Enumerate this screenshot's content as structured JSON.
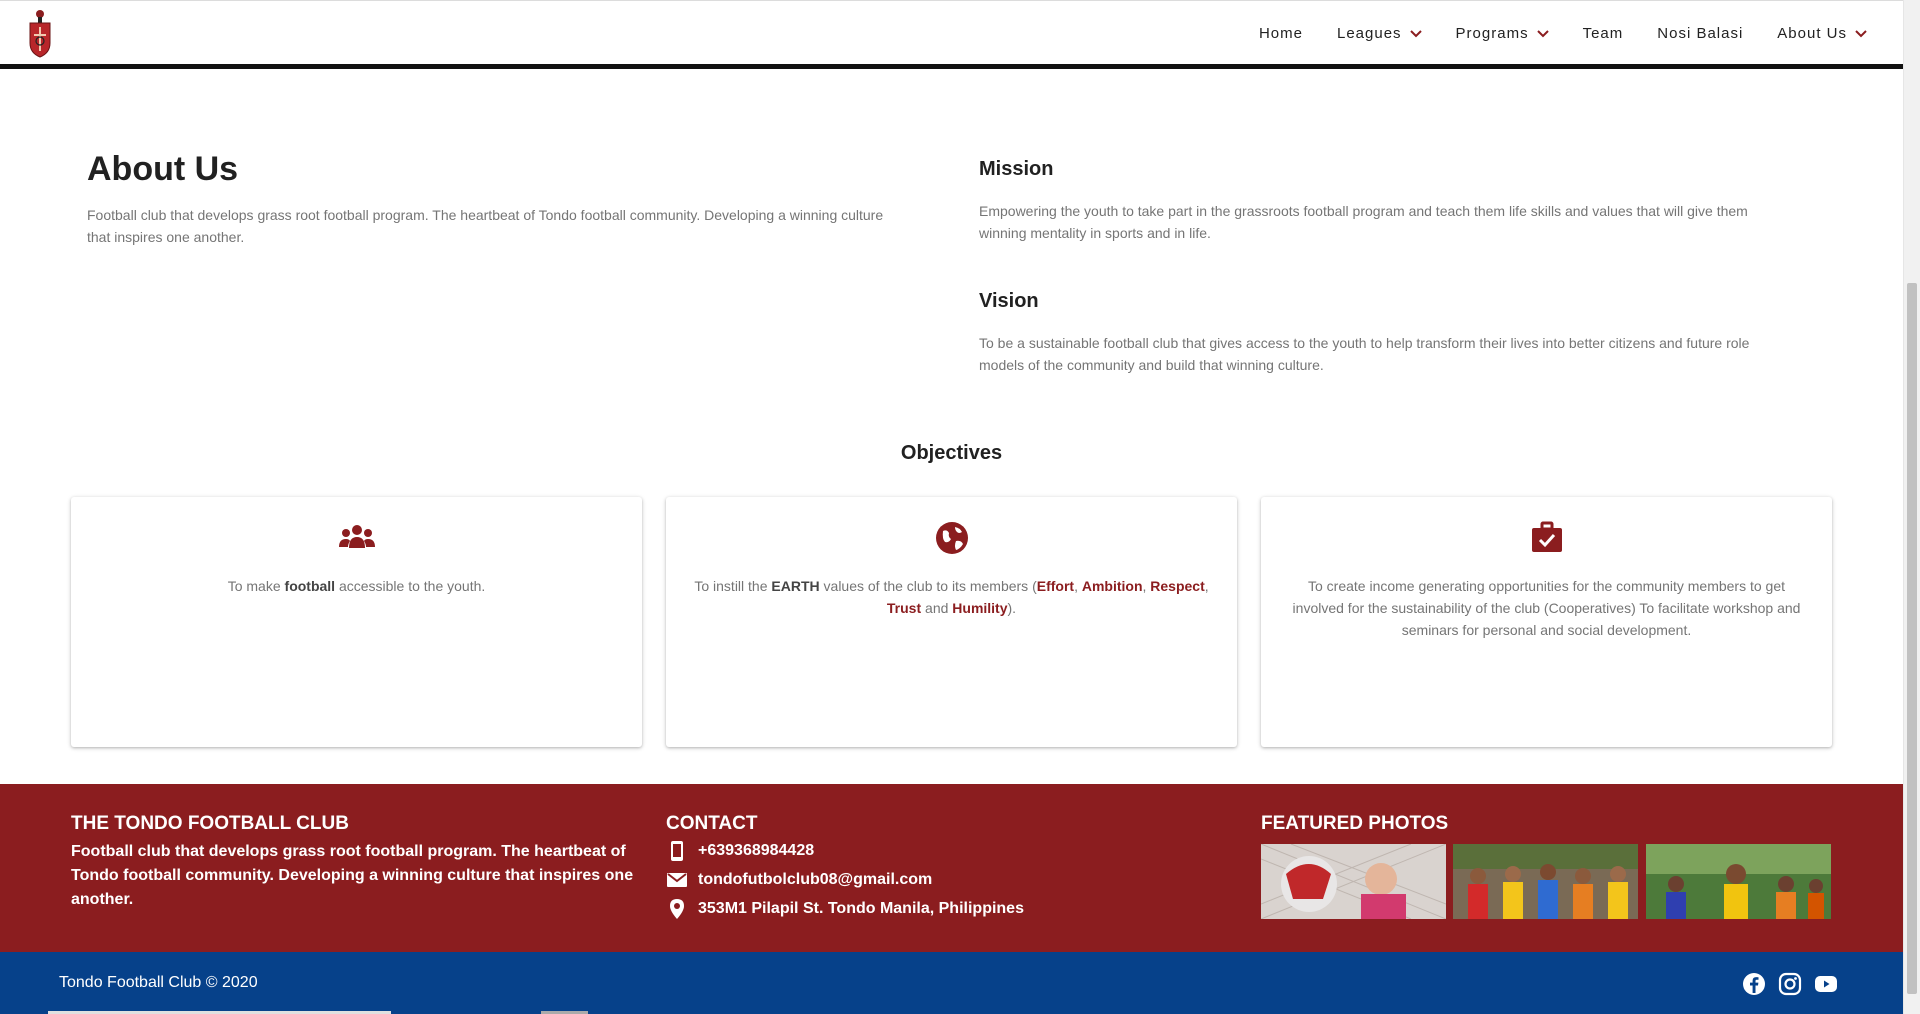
{
  "nav": {
    "logo_alt": "Tondo Football Club crest",
    "items": [
      {
        "label": "Home",
        "has_dropdown": false
      },
      {
        "label": "Leagues",
        "has_dropdown": true
      },
      {
        "label": "Programs",
        "has_dropdown": true
      },
      {
        "label": "Team",
        "has_dropdown": false
      },
      {
        "label": "Nosi Balasi",
        "has_dropdown": false
      },
      {
        "label": "About Us",
        "has_dropdown": true
      }
    ]
  },
  "about": {
    "title": "About Us",
    "text": "Football club that develops grass root football program. The heartbeat of Tondo football community. Developing a winning culture that inspires one another."
  },
  "mission": {
    "title": "Mission",
    "text": "Empowering the youth to take part in the grassroots football program and teach them life skills and values that will give them winning mentality in sports and in life."
  },
  "vision": {
    "title": "Vision",
    "text": "To be a sustainable football club that gives access to the youth to help transform their lives into better citizens and future role models of the community and build that winning culture."
  },
  "objectives": {
    "title": "Objectives",
    "cards": [
      {
        "icon": "group-icon",
        "pre": "To make ",
        "bold": "football",
        "post": " accessible to the youth."
      },
      {
        "icon": "globe-icon",
        "pre": "To instill the ",
        "bold": "EARTH",
        "mid": " values of the club to its members (",
        "values": [
          "Effort",
          "Ambition",
          "Respect",
          "Trust",
          "Humility"
        ],
        "and": "and",
        "end": ")."
      },
      {
        "icon": "briefcase-check-icon",
        "text": "To create income generating opportunities for the community members to get involved for the sustainability of the club (Cooperatives) To facilitate workshop and seminars for personal and social development."
      }
    ]
  },
  "footer": {
    "club_title": "THE TONDO FOOTBALL CLUB",
    "club_text": "Football club that develops grass root football program. The heartbeat of Tondo football community. Developing a winning culture that inspires one another.",
    "contact_title": "CONTACT",
    "phone": "+639368984428",
    "email": "tondofutbolclub08@gmail.com",
    "address": "353M1 Pilapil St. Tondo Manila, Philippines",
    "photos_title": "FEATURED PHOTOS"
  },
  "copyright": {
    "text": "Tondo Football Club © 2020",
    "social": [
      "facebook-icon",
      "instagram-icon",
      "youtube-icon"
    ]
  },
  "colors": {
    "brand_red": "#8b1d1f",
    "footer_blue": "#06418a"
  }
}
